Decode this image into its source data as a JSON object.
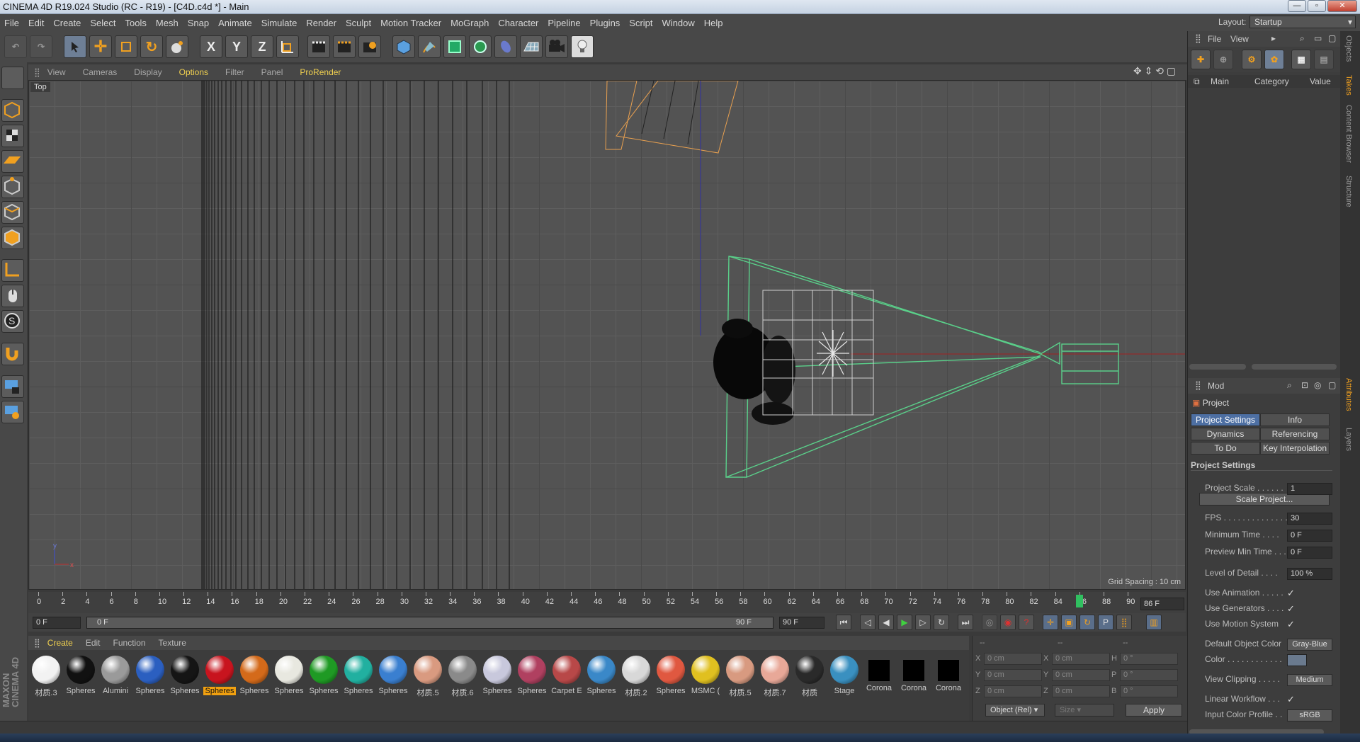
{
  "app": {
    "title": "CINEMA 4D R19.024 Studio (RC - R19) - [C4D.c4d *] - Main",
    "min": "—",
    "max": "▫",
    "close": "✕"
  },
  "menu": [
    "File",
    "Edit",
    "Create",
    "Select",
    "Tools",
    "Mesh",
    "Snap",
    "Animate",
    "Simulate",
    "Render",
    "Sculpt",
    "Motion Tracker",
    "MoGraph",
    "Character",
    "Pipeline",
    "Plugins",
    "Script",
    "Window",
    "Help"
  ],
  "layout": {
    "label": "Layout:",
    "value": "Startup"
  },
  "toolbar": {
    "x": "X",
    "y": "Y",
    "z": "Z"
  },
  "viewport_menu": [
    "View",
    "Cameras",
    "Display",
    "Options",
    "Filter",
    "Panel",
    "ProRender"
  ],
  "viewport": {
    "name": "Top",
    "grid_spacing": "Grid Spacing : 10 cm",
    "axis_y": "y",
    "axis_x": "x"
  },
  "timeline": {
    "ticks": [
      "0",
      "2",
      "4",
      "6",
      "8",
      "10",
      "12",
      "14",
      "16",
      "18",
      "20",
      "22",
      "24",
      "26",
      "28",
      "30",
      "32",
      "34",
      "36",
      "38",
      "40",
      "42",
      "44",
      "46",
      "48",
      "50",
      "52",
      "54",
      "56",
      "58",
      "60",
      "62",
      "64",
      "66",
      "68",
      "70",
      "72",
      "74",
      "76",
      "78",
      "80",
      "82",
      "84",
      "86",
      "88",
      "90"
    ],
    "current_frame": "86 F",
    "playhead": 86,
    "start": "0 F",
    "range_start": "0 F",
    "range_end": "90 F",
    "end": "90 F"
  },
  "material_menu": [
    "Create",
    "Edit",
    "Function",
    "Texture"
  ],
  "materials": [
    {
      "label": "材质.3",
      "color": "#f2f2f2"
    },
    {
      "label": "Spheres",
      "color": "#111111"
    },
    {
      "label": "Alumini",
      "color": "#9a9a9a"
    },
    {
      "label": "Spheres",
      "color": "#2b5fc0"
    },
    {
      "label": "Spheres",
      "color": "#151515"
    },
    {
      "label": "Spheres",
      "color": "#c8141e"
    },
    {
      "label": "Spheres",
      "color": "#d46a1a"
    },
    {
      "label": "Spheres",
      "color": "#e8e8e0"
    },
    {
      "label": "Spheres",
      "color": "#1f9a24"
    },
    {
      "label": "Spheres",
      "color": "#21b0a0"
    },
    {
      "label": "Spheres",
      "color": "#3a7fd0"
    },
    {
      "label": "材质.5",
      "color": "#d99a80"
    },
    {
      "label": "材质.6",
      "color": "#8a8a8a"
    },
    {
      "label": "Spheres",
      "color": "#c8c8dc"
    },
    {
      "label": "Spheres",
      "color": "#b04060"
    },
    {
      "label": "Carpet E",
      "color": "#b84848"
    },
    {
      "label": "Spheres",
      "color": "#3a88c8"
    },
    {
      "label": "材质.2",
      "color": "#d8d8d8"
    },
    {
      "label": "Spheres",
      "color": "#e05840"
    },
    {
      "label": "MSMC (",
      "color": "#e0c020"
    },
    {
      "label": "材质.5",
      "color": "#d89a80"
    },
    {
      "label": "材质.7",
      "color": "#e8a898"
    },
    {
      "label": "材质",
      "color": "#2a2a2a"
    },
    {
      "label": "Stage",
      "color": "#3a90c0"
    },
    {
      "label": "Corona",
      "color": "#000000"
    },
    {
      "label": "Corona",
      "color": "#000000"
    },
    {
      "label": "Corona",
      "color": "#000000"
    }
  ],
  "coords": {
    "headers": [
      "--",
      "--",
      "--"
    ],
    "rows": [
      {
        "a": "X",
        "av": "0 cm",
        "b": "X",
        "bv": "0 cm",
        "c": "H",
        "cv": "0 °"
      },
      {
        "a": "Y",
        "av": "0 cm",
        "b": "Y",
        "bv": "0 cm",
        "c": "P",
        "cv": "0 °"
      },
      {
        "a": "Z",
        "av": "0 cm",
        "b": "Z",
        "bv": "0 cm",
        "c": "B",
        "cv": "0 °"
      }
    ],
    "mode": "Object (Rel)",
    "size": "Size",
    "apply": "Apply"
  },
  "objects_panel": {
    "file": "File",
    "view": "View",
    "main": "Main",
    "category": "Category",
    "value": "Value"
  },
  "attributes": {
    "mode": "Mod",
    "object": "Project",
    "tabs": [
      "Project Settings",
      "Info",
      "Dynamics",
      "Referencing",
      "To Do",
      "Key Interpolation"
    ],
    "section": "Project Settings",
    "rows": [
      {
        "label": "Project Scale . . . . . .",
        "value": "1"
      },
      {
        "label": "FPS . . . . . . . . . . . . . .",
        "value": "30"
      },
      {
        "label": "Minimum Time . . . .",
        "value": "0 F"
      },
      {
        "label": "Preview Min Time . . .",
        "value": "0 F"
      },
      {
        "label": "Level of Detail . . . .",
        "value": "100 %"
      },
      {
        "label": "Use Animation . . . . .",
        "value": "✓"
      },
      {
        "label": "Use Generators . . . .",
        "value": "✓"
      },
      {
        "label": "Use Motion System",
        "value": "✓"
      },
      {
        "label": "Default Object Color",
        "value": "Gray-Blue"
      },
      {
        "label": "Color . . . . . . . . . . . .",
        "value": ""
      },
      {
        "label": "View Clipping . . . . .",
        "value": "Medium"
      },
      {
        "label": "Linear Workflow . . .",
        "value": "✓"
      },
      {
        "label": "Input Color Profile . .",
        "value": "sRGB"
      }
    ],
    "scale_button": "Scale Project..."
  },
  "side_tabs": [
    "Objects",
    "Takes",
    "Content Browser",
    "Structure",
    "Attributes",
    "Layers"
  ],
  "brand": {
    "line1": "MAXON",
    "line2": "CINEMA 4D"
  }
}
